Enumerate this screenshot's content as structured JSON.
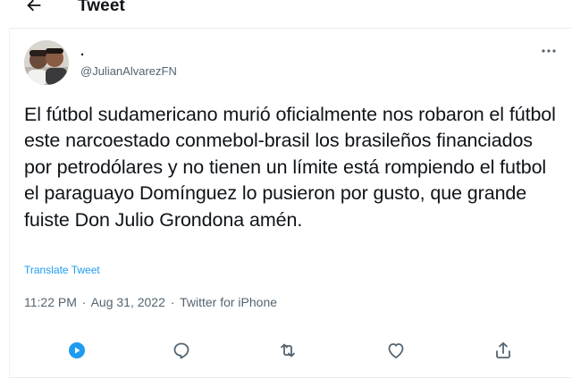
{
  "header": {
    "back_icon": "arrow-left-icon",
    "title": "Tweet"
  },
  "tweet": {
    "display_name": ".",
    "handle": "@JulianAlvarezFN",
    "more_icon": "more-horizontal-icon",
    "text": "El fútbol sudamericano murió oficialmente nos robaron el fútbol este narcoestado conmebol-brasil los brasileños financiados por petrodólares y no tienen un límite está rompiendo el futbol el paraguayo Domínguez lo pusieron por gusto, que grande fuiste Don Julio Grondona amén.",
    "translate_label": "Translate Tweet",
    "time": "11:22 PM",
    "date": "Aug 31, 2022",
    "source": "Twitter for iPhone",
    "separator": "·"
  },
  "actions": [
    {
      "name": "spaces-play-icon",
      "color": "#1d9bf0"
    },
    {
      "name": "reply-icon",
      "color": "#536471"
    },
    {
      "name": "retweet-icon",
      "color": "#536471"
    },
    {
      "name": "like-icon",
      "color": "#536471"
    },
    {
      "name": "share-icon",
      "color": "#536471"
    }
  ],
  "colors": {
    "accent": "#1d9bf0",
    "secondary_text": "#536471",
    "primary_text": "#0f1419"
  }
}
